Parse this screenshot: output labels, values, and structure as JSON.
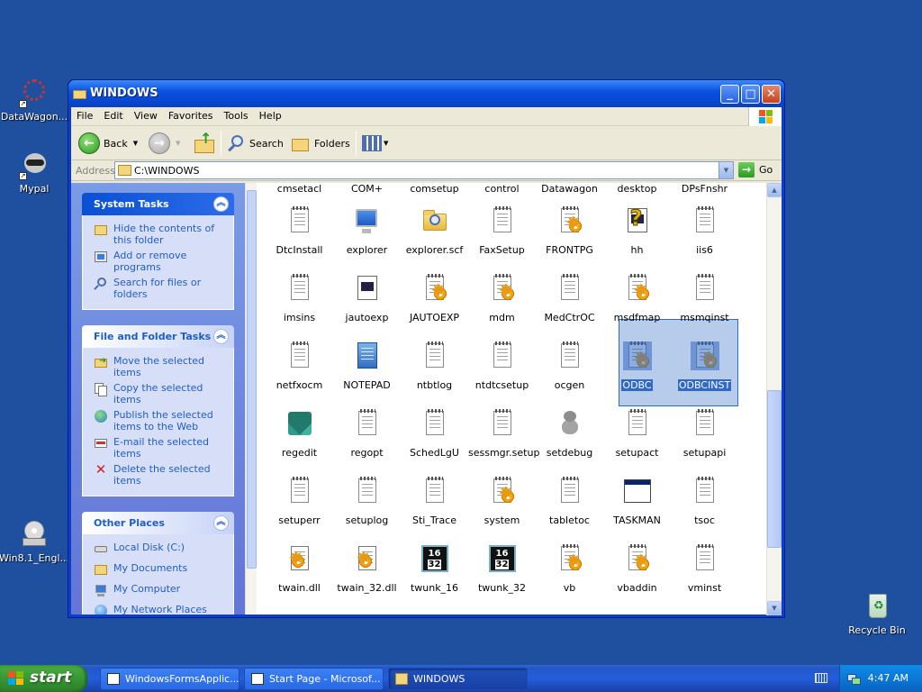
{
  "desktop": {
    "icons": [
      {
        "label": "DataWagon...",
        "icon": "datawagon-icon"
      },
      {
        "label": "Mypal",
        "icon": "raccoon-icon"
      },
      {
        "label": "Win8.1_Engl...",
        "icon": "cd-drive-icon"
      },
      {
        "label": "Recycle Bin",
        "icon": "recycle-bin-icon"
      }
    ]
  },
  "window": {
    "title": "WINDOWS",
    "menu": [
      "File",
      "Edit",
      "View",
      "Favorites",
      "Tools",
      "Help"
    ],
    "toolbar": {
      "back_label": "Back",
      "search_label": "Search",
      "folders_label": "Folders"
    },
    "address": {
      "label": "Address",
      "value": "C:\\WINDOWS",
      "go_label": "Go"
    }
  },
  "taskpane": {
    "system_tasks": {
      "title": "System Tasks",
      "items": [
        {
          "label": "Hide the contents of this folder",
          "icon": "hide-contents-icon"
        },
        {
          "label": "Add or remove programs",
          "icon": "add-remove-programs-icon"
        },
        {
          "label": "Search for files or folders",
          "icon": "search-icon"
        }
      ]
    },
    "file_folder_tasks": {
      "title": "File and Folder Tasks",
      "items": [
        {
          "label": "Move the selected items",
          "icon": "move-icon"
        },
        {
          "label": "Copy the selected items",
          "icon": "copy-icon"
        },
        {
          "label": "Publish the selected items to the Web",
          "icon": "publish-web-icon"
        },
        {
          "label": "E-mail the selected items",
          "icon": "email-icon"
        },
        {
          "label": "Delete the selected items",
          "icon": "delete-icon"
        }
      ]
    },
    "other_places": {
      "title": "Other Places",
      "items": [
        {
          "label": "Local Disk (C:)",
          "icon": "local-disk-icon"
        },
        {
          "label": "My Documents",
          "icon": "my-documents-icon"
        },
        {
          "label": "My Computer",
          "icon": "my-computer-icon"
        },
        {
          "label": "My Network Places",
          "icon": "network-places-icon"
        }
      ]
    }
  },
  "files": {
    "partial_top_row": [
      "cmsetacl",
      "COM+",
      "comsetup",
      "control",
      "Datawagon",
      "desktop",
      "DPsFnshr"
    ],
    "rows": [
      [
        {
          "name": "DtcInstall",
          "icon": "text-file-icon"
        },
        {
          "name": "explorer",
          "icon": "computer-icon"
        },
        {
          "name": "explorer.scf",
          "icon": "folder-search-icon"
        },
        {
          "name": "FaxSetup",
          "icon": "text-file-icon"
        },
        {
          "name": "FRONTPG",
          "icon": "config-file-icon"
        },
        {
          "name": "hh",
          "icon": "help-icon"
        },
        {
          "name": "iis6",
          "icon": "text-file-icon"
        }
      ],
      [
        {
          "name": "imsins",
          "icon": "text-file-icon"
        },
        {
          "name": "jautoexp",
          "icon": "program-file-icon"
        },
        {
          "name": "JAUTOEXP",
          "icon": "config-file-icon"
        },
        {
          "name": "mdm",
          "icon": "config-file-icon"
        },
        {
          "name": "MedCtrOC",
          "icon": "text-file-icon"
        },
        {
          "name": "msdfmap",
          "icon": "config-file-icon"
        },
        {
          "name": "msmqinst",
          "icon": "text-file-icon"
        }
      ],
      [
        {
          "name": "netfxocm",
          "icon": "text-file-icon"
        },
        {
          "name": "NOTEPAD",
          "icon": "notepad-icon"
        },
        {
          "name": "ntbtlog",
          "icon": "text-file-icon"
        },
        {
          "name": "ntdtcsetup",
          "icon": "text-file-icon"
        },
        {
          "name": "ocgen",
          "icon": "text-file-icon"
        },
        {
          "name": "ODBC",
          "icon": "config-file-icon",
          "selected": true
        },
        {
          "name": "ODBCINST",
          "icon": "config-file-icon",
          "selected": true
        }
      ],
      [
        {
          "name": "regedit",
          "icon": "registry-editor-icon"
        },
        {
          "name": "regopt",
          "icon": "text-file-icon"
        },
        {
          "name": "SchedLgU",
          "icon": "text-file-icon"
        },
        {
          "name": "sessmgr.setup",
          "icon": "text-file-icon"
        },
        {
          "name": "setdebug",
          "icon": "teddy-bear-icon"
        },
        {
          "name": "setupact",
          "icon": "text-file-icon"
        },
        {
          "name": "setupapi",
          "icon": "text-file-icon"
        }
      ],
      [
        {
          "name": "setuperr",
          "icon": "text-file-icon"
        },
        {
          "name": "setuplog",
          "icon": "text-file-icon"
        },
        {
          "name": "Sti_Trace",
          "icon": "text-file-icon"
        },
        {
          "name": "system",
          "icon": "config-file-icon"
        },
        {
          "name": "tabletoc",
          "icon": "text-file-icon"
        },
        {
          "name": "TASKMAN",
          "icon": "window-app-icon"
        },
        {
          "name": "tsoc",
          "icon": "text-file-icon"
        }
      ],
      [
        {
          "name": "twain.dll",
          "icon": "dll-file-icon"
        },
        {
          "name": "twain_32.dll",
          "icon": "dll-file-icon"
        },
        {
          "name": "twunk_16",
          "icon": "win16-app-icon"
        },
        {
          "name": "twunk_32",
          "icon": "win16-app-icon"
        },
        {
          "name": "vb",
          "icon": "config-file-icon"
        },
        {
          "name": "vbaddin",
          "icon": "config-file-icon"
        },
        {
          "name": "vminst",
          "icon": "text-file-icon"
        }
      ]
    ],
    "win16_badge": {
      "top": "16",
      "bottom": "32"
    }
  },
  "taskbar": {
    "start_label": "start",
    "items": [
      {
        "label": "WindowsFormsApplic...",
        "active": false
      },
      {
        "label": "Start Page - Microsof...",
        "active": false
      },
      {
        "label": "WINDOWS",
        "active": true
      }
    ],
    "clock": "4:47 AM"
  },
  "colors": {
    "desktop": "#1f4f9f",
    "selection": "#316ac5",
    "task_link": "#215dc6",
    "start_green": "#3c9b36"
  }
}
